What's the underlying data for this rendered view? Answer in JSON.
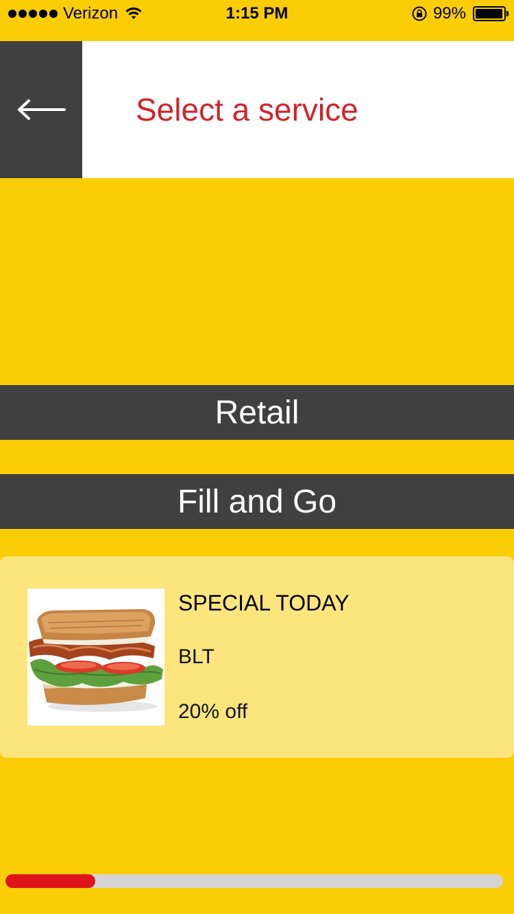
{
  "status_bar": {
    "carrier": "Verizon",
    "time": "1:15 PM",
    "battery": "99%"
  },
  "header": {
    "title": "Select a service",
    "back_icon": "arrow-left-icon"
  },
  "services": {
    "retail_label": "Retail",
    "fill_and_go_label": "Fill and Go"
  },
  "special": {
    "title": "SPECIAL TODAY",
    "item": "BLT",
    "discount": "20% off",
    "image_icon": "sandwich-image"
  },
  "progress": {
    "fraction": 0.18,
    "fill_color": "#E0141B"
  },
  "colors": {
    "background": "#FBCD07",
    "accent": "#D2232A",
    "button_dark": "#404040",
    "card": "#FDE57E"
  }
}
